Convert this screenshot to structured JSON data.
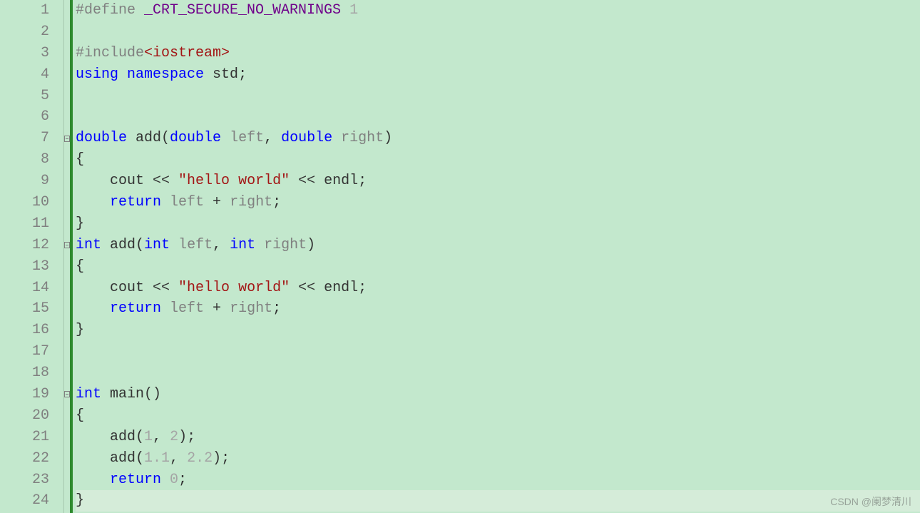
{
  "line_count": 24,
  "fold_lines": [
    7,
    12,
    19
  ],
  "current_line": 24,
  "watermark": "CSDN @阑梦清川",
  "code": {
    "l1": {
      "preproc": "#define",
      "macro": " _CRT_SECURE_NO_WARNINGS",
      "val": " 1"
    },
    "l3": {
      "preproc": "#include",
      "inc": "<iostream>"
    },
    "l4": {
      "kw1": "using",
      "kw2": " namespace",
      "id": " std",
      "semi": ";"
    },
    "l7": {
      "t1": "double",
      "id": " add",
      "p1": "(",
      "t2": "double",
      "pn1": " left",
      "c": ",",
      "t3": " double",
      "pn2": " right",
      "p2": ")"
    },
    "l8": "{",
    "l9": {
      "indent": "    ",
      "id1": "cout",
      "op1": " <<",
      "str": " \"hello world\"",
      "op2": " <<",
      "id2": " endl",
      "semi": ";"
    },
    "l10": {
      "indent": "    ",
      "kw": "return",
      "p1": " left",
      "plus": " +",
      "p2": " right",
      "semi": ";"
    },
    "l11": "}",
    "l12": {
      "t1": "int",
      "id": " add",
      "p1": "(",
      "t2": "int",
      "pn1": " left",
      "c": ",",
      "t3": " int",
      "pn2": " right",
      "p2": ")"
    },
    "l13": "{",
    "l14": {
      "indent": "    ",
      "id1": "cout",
      "op1": " <<",
      "str": " \"hello world\"",
      "op2": " <<",
      "id2": " endl",
      "semi": ";"
    },
    "l15": {
      "indent": "    ",
      "kw": "return",
      "p1": " left",
      "plus": " +",
      "p2": " right",
      "semi": ";"
    },
    "l16": "}",
    "l19": {
      "t1": "int",
      "id": " main",
      "p1": "(",
      "p2": ")"
    },
    "l20": "{",
    "l21": {
      "indent": "    ",
      "id": "add",
      "p1": "(",
      "n1": "1",
      "c": ",",
      "n2": " 2",
      "p2": ")",
      "semi": ";"
    },
    "l22": {
      "indent": "    ",
      "id": "add",
      "p1": "(",
      "n1": "1.1",
      "c": ",",
      "n2": " 2.2",
      "p2": ")",
      "semi": ";"
    },
    "l23": {
      "indent": "    ",
      "kw": "return",
      "n": " 0",
      "semi": ";"
    },
    "l24": "}"
  }
}
